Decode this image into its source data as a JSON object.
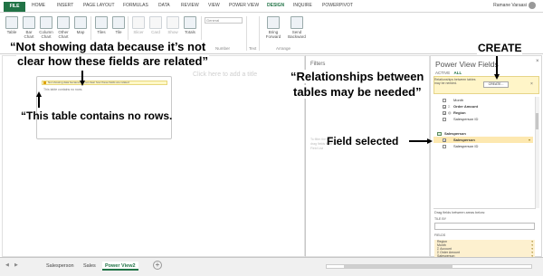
{
  "ribbon_tabs": {
    "file": "FILE",
    "tabs": [
      "HOME",
      "INSERT",
      "PAGE LAYOUT",
      "FORMULAS",
      "DATA",
      "REVIEW",
      "VIEW",
      "POWER VIEW",
      "DESIGN",
      "INQUIRE",
      "POWERPIVOT"
    ],
    "active_tab": "DESIGN",
    "user": "Ramane Varaasi"
  },
  "ribbon": {
    "buttons": [
      "Table",
      "Bar Chart",
      "Column Chart",
      "Other Chart",
      "Map",
      "Tiles",
      "Tile",
      "Slicer",
      "Card",
      "Show",
      "Totals",
      "Bring Forward",
      "Send Backward"
    ],
    "number_format": "General",
    "groups": [
      "Switch Visualization",
      "Number",
      "Text",
      "Arrange"
    ]
  },
  "canvas": {
    "ghost_title": "Click here to add a title",
    "message": "Not showing data because it's not clear how these fields are related",
    "no_rows": "This table contains no rows."
  },
  "filters_pane": {
    "title": "Filters",
    "tabs": "VIEW   TABLE",
    "body": "To filter the view, drag fields from the Field List"
  },
  "fields_pane": {
    "title": "Power View Fields",
    "close": "×",
    "tab_active": "ACTIVE",
    "tab_all": "ALL",
    "relationship_text": "Relationships between tables may be needed.",
    "create_label": "CREATE...",
    "list": [
      {
        "label": "Month",
        "sigma": false,
        "checked": false,
        "bold": false,
        "indent": 1
      },
      {
        "label": "Order Amount",
        "sigma": true,
        "checked": true,
        "bold": true,
        "indent": 1
      },
      {
        "label": "Region",
        "sigma": false,
        "checked": true,
        "bold": true,
        "indent": 1
      },
      {
        "label": "Salesperson ID",
        "sigma": true,
        "checked": false,
        "bold": false,
        "indent": 1
      },
      {
        "label": "Salesperson",
        "table": true,
        "bold": true,
        "indent": 0
      },
      {
        "label": "Salesperson",
        "sigma": false,
        "checked": true,
        "bold": true,
        "indent": 1,
        "highlight": true
      },
      {
        "label": "Salesperson ID",
        "sigma": true,
        "checked": false,
        "bold": false,
        "indent": 1
      }
    ],
    "drag_text": "Drag fields between areas below:",
    "tile_by": "TILE BY",
    "fields_label": "FIELDS",
    "fields_area": [
      "Region",
      "Month",
      "Σ Account",
      "Σ Order Amount",
      "Salesperson"
    ]
  },
  "sheets": {
    "tabs": [
      "Salesperson",
      "Sales",
      "Power View2"
    ],
    "active": "Power View2",
    "add": "+"
  },
  "annotations": {
    "not_showing": "“Not showing data because it’s not",
    "not_showing2": "clear how these fields are related”",
    "no_rows": "“This table contains no rows.",
    "create": "CREATE",
    "relationships1": "“Relationships between",
    "relationships2": "tables may be needed”",
    "field_selected": "Field selected"
  }
}
